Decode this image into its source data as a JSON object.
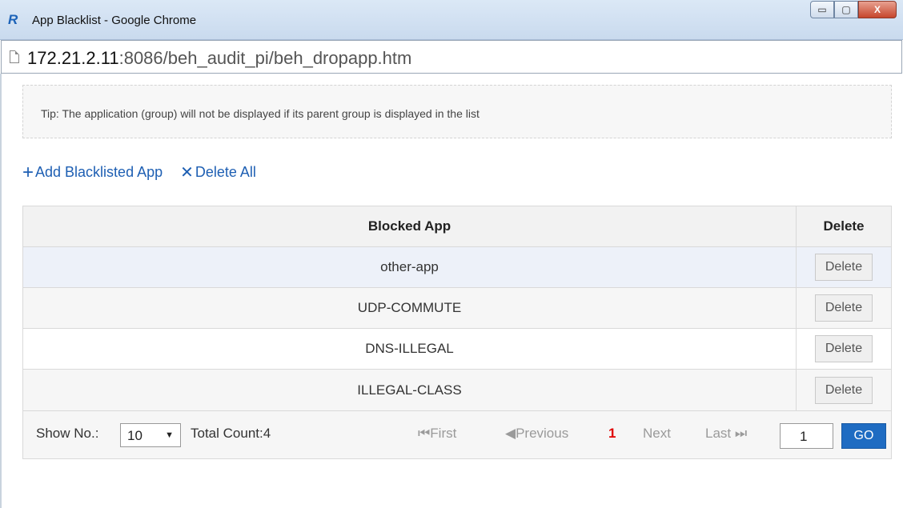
{
  "window": {
    "title": "App Blacklist - Google Chrome",
    "controls": {
      "minimize": "▭",
      "maximize": "▢",
      "close": "X"
    }
  },
  "address": {
    "host": "172.21.2.11",
    "path": ":8086/beh_audit_pi/beh_dropapp.htm"
  },
  "tip": "Tip: The application (group) will not be displayed if its parent group is displayed in the list",
  "actions": {
    "add_icon": "+",
    "add_label": "Add Blacklisted App",
    "delete_icon": "✕",
    "delete_label": "Delete All"
  },
  "table": {
    "headers": {
      "app": "Blocked App",
      "delete": "Delete"
    },
    "rows": [
      {
        "app": "other-app",
        "action": "Delete"
      },
      {
        "app": "UDP-COMMUTE",
        "action": "Delete"
      },
      {
        "app": "DNS-ILLEGAL",
        "action": "Delete"
      },
      {
        "app": "ILLEGAL-CLASS",
        "action": "Delete"
      }
    ]
  },
  "pager": {
    "show_label": "Show No.:",
    "page_size": "10",
    "page_size_arrow": "▼",
    "total": "Total Count:4",
    "first": "⏮First",
    "previous": "◀Previous",
    "current_page": "1",
    "next": "Next",
    "last": "Last ⏭",
    "page_input": "1",
    "go": "GO"
  },
  "colors": {
    "link": "#1e5fb3",
    "go_button": "#1f6cc2",
    "current_page": "#e00000"
  }
}
